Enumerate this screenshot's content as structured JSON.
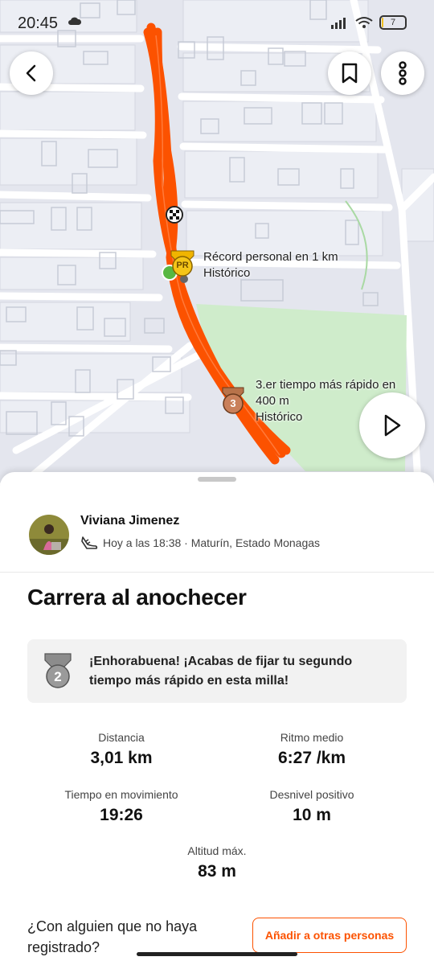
{
  "status_bar": {
    "time": "20:45",
    "battery": "7",
    "battery_level": 0.07
  },
  "map": {
    "pr_badge": "PR",
    "pr_label": "Récord personal en 1 km",
    "pr_sublabel": "Histórico",
    "third_badge": "3",
    "third_label_line1": "3.er tiempo más rápido en",
    "third_label_line2": "400 m",
    "third_sublabel": "Histórico",
    "route_color": "#fc5200"
  },
  "activity": {
    "athlete_name": "Viviana Jimenez",
    "meta": "Hoy a las 18:38 · Maturín, Estado Monagas",
    "title": "Carrera al anochecer",
    "achievement_badge": "2",
    "achievement_text": "¡Enhorabuena! ¡Acabas de fijar tu segundo tiempo más rápido en esta milla!",
    "stats": {
      "distance_label": "Distancia",
      "distance_value": "3,01 km",
      "pace_label": "Ritmo medio",
      "pace_value": "6:27 /km",
      "moving_time_label": "Tiempo en movimiento",
      "moving_time_value": "19:26",
      "elevation_label": "Desnivel positivo",
      "elevation_value": "10 m",
      "max_alt_label": "Altitud máx.",
      "max_alt_value": "83 m"
    },
    "question": "¿Con alguien que no haya registrado?",
    "add_people_button": "Añadir a otras personas"
  },
  "colors": {
    "accent": "#fc5200",
    "park": "#cfeccb",
    "map_bg": "#e4e6ee"
  }
}
